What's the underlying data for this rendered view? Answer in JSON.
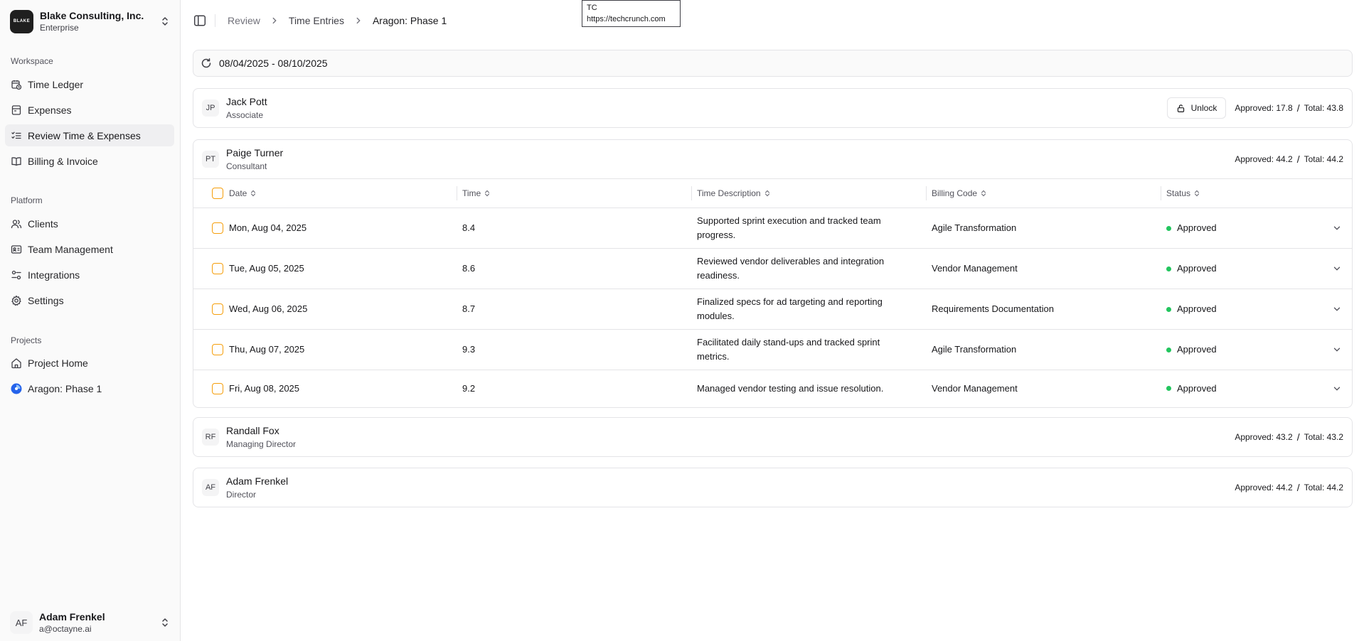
{
  "sidebar": {
    "org": {
      "logo_text": "BLAKE",
      "name": "Blake Consulting, Inc.",
      "plan": "Enterprise"
    },
    "sections": {
      "workspace": "Workspace",
      "platform": "Platform",
      "projects": "Projects"
    },
    "workspace_items": [
      {
        "label": "Time Ledger",
        "icon": "clock-icon"
      },
      {
        "label": "Expenses",
        "icon": "receipt-icon"
      },
      {
        "label": "Review Time & Expenses",
        "icon": "list-check-icon"
      },
      {
        "label": "Billing & Invoice",
        "icon": "book-icon"
      }
    ],
    "platform_items": [
      {
        "label": "Clients",
        "icon": "users-icon"
      },
      {
        "label": "Team Management",
        "icon": "id-card-icon"
      },
      {
        "label": "Integrations",
        "icon": "sliders-icon"
      },
      {
        "label": "Settings",
        "icon": "gear-icon"
      }
    ],
    "project_items": [
      {
        "label": "Project Home",
        "icon": "home-icon"
      },
      {
        "label": "Aragon: Phase 1",
        "icon": "project-logo-icon"
      }
    ],
    "user": {
      "initials": "AF",
      "name": "Adam Frenkel",
      "email": "a@octayne.ai"
    }
  },
  "header": {
    "breadcrumb": [
      "Review",
      "Time Entries",
      "Aragon: Phase 1"
    ]
  },
  "tooltip": {
    "line1": "TC",
    "line2": "https://techcrunch.com"
  },
  "date_range": "08/04/2025 - 08/10/2025",
  "people": [
    {
      "initials": "JP",
      "name": "Jack Pott",
      "role": "Associate",
      "approved": "Approved: 17.8",
      "total": "Total: 43.8",
      "unlock_label": "Unlock"
    },
    {
      "initials": "PT",
      "name": "Paige Turner",
      "role": "Consultant",
      "approved": "Approved: 44.2",
      "total": "Total: 44.2"
    },
    {
      "initials": "RF",
      "name": "Randall Fox",
      "role": "Managing Director",
      "approved": "Approved: 43.2",
      "total": "Total: 43.2"
    },
    {
      "initials": "AF",
      "name": "Adam Frenkel",
      "role": "Director",
      "approved": "Approved: 44.2",
      "total": "Total: 44.2"
    }
  ],
  "table": {
    "columns": [
      "Date",
      "Time",
      "Time Description",
      "Billing Code",
      "Status"
    ],
    "rows": [
      {
        "date": "Mon, Aug 04, 2025",
        "time": "8.4",
        "description": "Supported sprint execution and tracked team progress.",
        "billing_code": "Agile Transformation",
        "status": "Approved"
      },
      {
        "date": "Tue, Aug 05, 2025",
        "time": "8.6",
        "description": "Reviewed vendor deliverables and integration readiness.",
        "billing_code": "Vendor Management",
        "status": "Approved"
      },
      {
        "date": "Wed, Aug 06, 2025",
        "time": "8.7",
        "description": "Finalized specs for ad targeting and reporting modules.",
        "billing_code": "Requirements Documentation",
        "status": "Approved"
      },
      {
        "date": "Thu, Aug 07, 2025",
        "time": "9.3",
        "description": "Facilitated daily stand-ups and tracked sprint metrics.",
        "billing_code": "Agile Transformation",
        "status": "Approved"
      },
      {
        "date": "Fri, Aug 08, 2025",
        "time": "9.2",
        "description": "Managed vendor testing and issue resolution.",
        "billing_code": "Vendor Management",
        "status": "Approved"
      }
    ]
  },
  "colors": {
    "accent_checkbox": "#f59e0b",
    "status_approved": "#22c55e",
    "sidebar_bg": "#fafafa"
  }
}
